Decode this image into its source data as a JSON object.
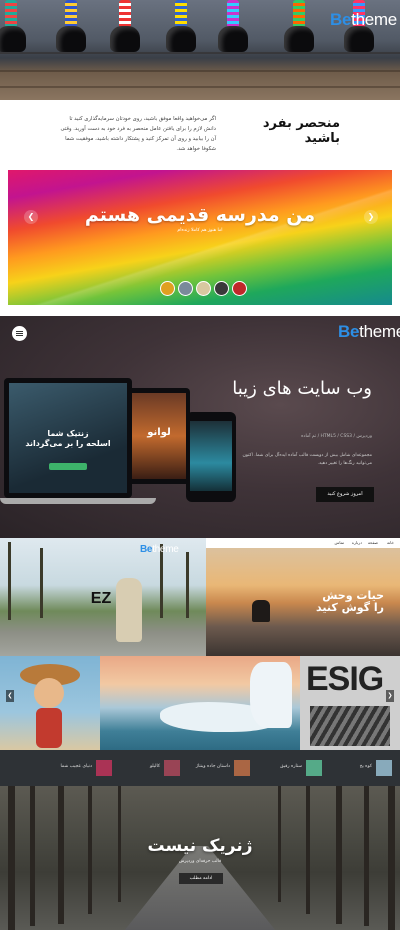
{
  "brand": {
    "prefix": "Be",
    "suffix": "theme"
  },
  "unique": {
    "title": "منحصر بفرد باشید",
    "body": "اگر می‌خواهید واقعا موفق باشید، روی خودتان سرمایه‌گذاری کنید تا دانش لازم را برای یافتن عامل منحصر به فرد خود به دست آورید. وقتی آن را بیابید و روی آن تمرکز کنید و پشتکار داشته باشید، موفقیت شما شکوفا خواهد شد."
  },
  "colorful_slider": {
    "title": "من مدرسه قدیمی هستم",
    "subtitle": "اما هنوز هم کاملا زنده‌ام",
    "prev_icon": "chevron-left-icon",
    "next_icon": "chevron-right-icon",
    "thumb_colors": [
      "#e0a020",
      "#7a8a9a",
      "#d8c8a0",
      "#3a3a3a",
      "#c0282a"
    ]
  },
  "websites": {
    "title": "وب سایت های زیبا",
    "tag": "وردپرس / HTML5 / CSS3 / تم آماده",
    "description": "مجموعه‌ای شامل بیش از دویست قالب آماده ایده‌آل برای شما. اکنون می‌توانید رنگ‌ها را تغییر دهید.",
    "button": "امروز شروع کنید",
    "menu_icon": "hamburger-menu-icon",
    "laptop_screen_text": "زنتیک شما\nاسلحه را بر می‌گرداند",
    "tablet_screen_text": "لوانو"
  },
  "grid": {
    "palms_overlay": "EZ",
    "sunset_title": "حیات وحش\nرا گوش کنید",
    "sunset_tabs": [
      "خانه",
      "صفحه",
      "درباره",
      "تماس"
    ],
    "design_text": "ESIG",
    "strip_items": [
      {
        "label": "کوه یخ",
        "color": "#8ab"
      },
      {
        "label": "ستاره رقیق",
        "color": "#5a8"
      },
      {
        "label": "داستان جاده وینتاژ",
        "color": "#a64"
      },
      {
        "label": "کالیلو",
        "color": "#945"
      },
      {
        "label": "دنیای عجیب شما",
        "color": "#a35"
      }
    ]
  },
  "forest": {
    "title": "ژنریک نیست",
    "subtitle": "قالب حرفه‌ای وردپرس",
    "button": "ادامه مطلب"
  }
}
